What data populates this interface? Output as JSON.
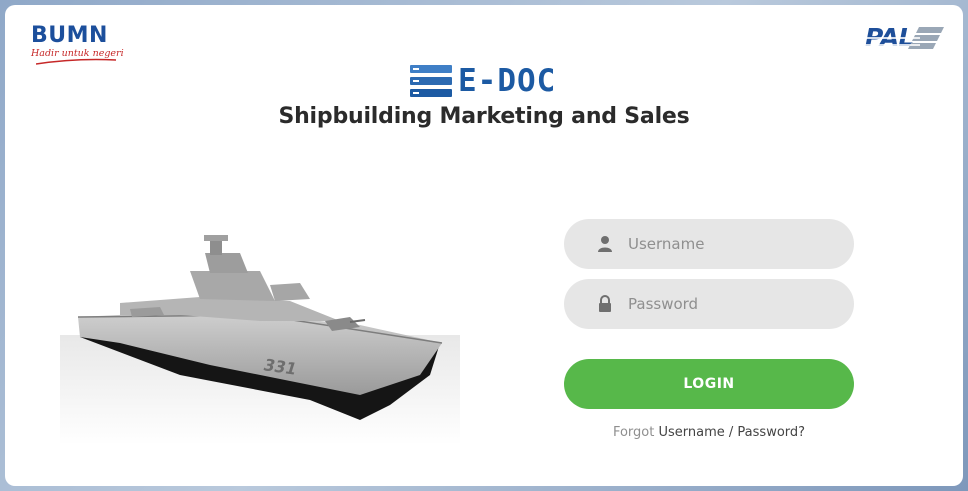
{
  "header": {
    "bumn_logo": {
      "word": "BUMN",
      "tagline": "Hadir untuk negeri"
    },
    "pal_logo": {
      "word": "PAL"
    },
    "app_logo": {
      "word": "E-DOC"
    },
    "title": "Shipbuilding Marketing and Sales"
  },
  "hero": {
    "hull_number": "331"
  },
  "login_form": {
    "username": {
      "placeholder": "Username",
      "value": "",
      "icon": "user-icon"
    },
    "password": {
      "placeholder": "Password",
      "value": "",
      "icon": "lock-icon"
    },
    "submit_label": "LOGIN",
    "forgot": {
      "prefix": "Forgot",
      "username_link": "Username",
      "separator": "/",
      "password_link": "Password?"
    }
  },
  "colors": {
    "brand_blue": "#1c5aa3",
    "login_green": "#57b84a",
    "field_bg": "#e6e6e6",
    "bumn_red": "#c62828"
  }
}
